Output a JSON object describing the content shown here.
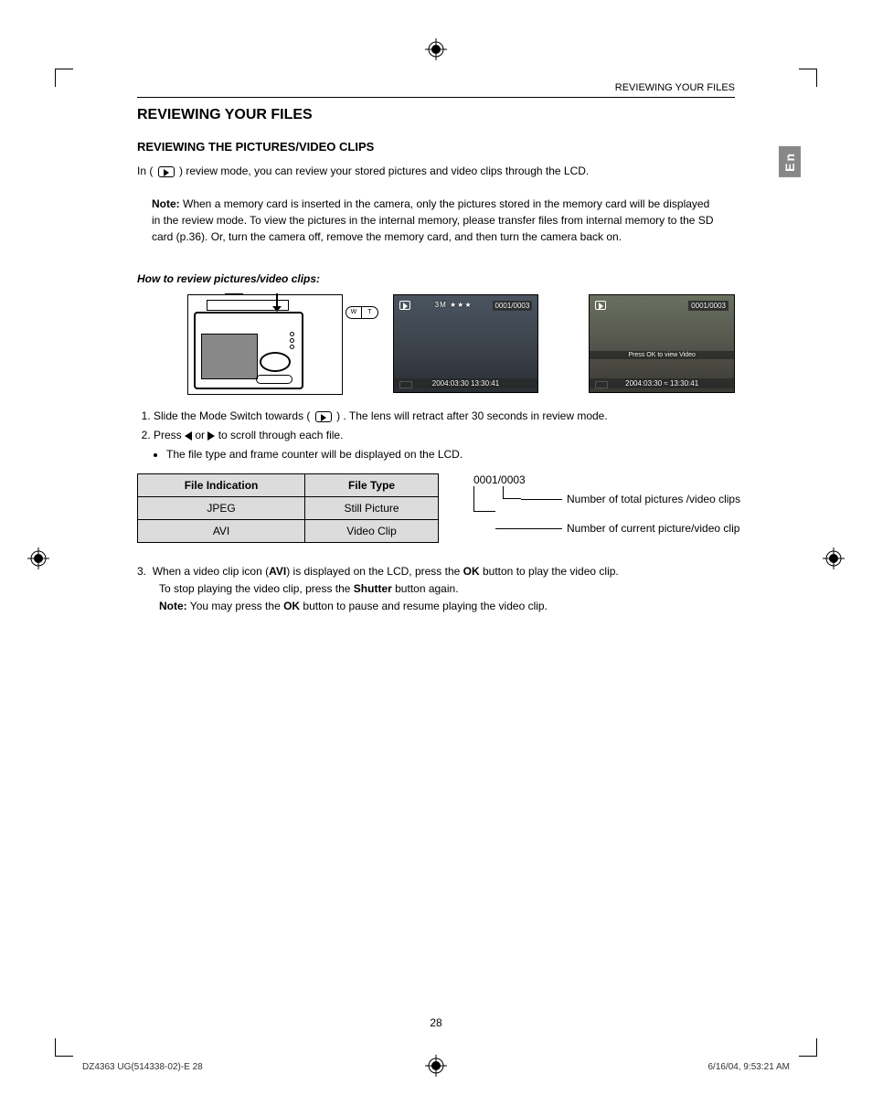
{
  "running_head": "REVIEWING YOUR FILES",
  "lang_tab": "En",
  "title": "REVIEWING YOUR FILES",
  "subtitle": "REVIEWING THE PICTURES/VIDEO CLIPS",
  "intro": "review mode, you can review your stored pictures and video clips through the LCD.",
  "intro_prefix": "In (",
  "intro_suffix": ")",
  "note_box": {
    "label": "Note:",
    "text": " When a memory card is inserted in the camera, only the pictures stored in the memory card will be displayed in the review mode. To view the pictures in the internal memory, please transfer files from internal memory to the SD card (p.36). Or, turn the camera off, remove the memory card, and then turn the camera back on."
  },
  "howto": "How to review pictures/video clips:",
  "lcd1": {
    "counter": "0001/0003",
    "stars": "3M ★★★",
    "datetime": "2004:03:30   13:30:41"
  },
  "lcd2": {
    "counter": "0001/0003",
    "press_ok": "Press OK to view Video",
    "datetime": "2004:03:30 ≈ 13:30:41"
  },
  "camera": {
    "slider_w": "W",
    "slider_t": "T"
  },
  "steps": {
    "s1a": "Slide the Mode Switch towards (",
    "s1b": ") . The lens will retract after 30 seconds in review mode.",
    "s2a": "Press ",
    "s2b": " or ",
    "s2c": " to scroll through each file.",
    "s2_bullet": "The file type and frame counter will be displayed on the LCD."
  },
  "table": {
    "h1": "File Indication",
    "h2": "File Type",
    "rows": [
      {
        "c1": "JPEG",
        "c2": "Still Picture"
      },
      {
        "c1": "AVI",
        "c2": "Video Clip"
      }
    ]
  },
  "counter_diagram": {
    "value": "0001/0003",
    "label1": "Number of total pictures /video clips",
    "label2": "Number of current picture/video clip"
  },
  "step3": {
    "num": "3.",
    "a": "When a video clip icon (",
    "avi": "AVI",
    "b": ") is displayed on the LCD, press the ",
    "ok": "OK",
    "c": " button to play the video clip.",
    "line2a": "To stop playing the video clip, press the ",
    "shutter": "Shutter",
    "line2b": " button again.",
    "note_label": "Note:",
    "note_a": " You may press the ",
    "note_b": " button to pause and resume playing the video clip."
  },
  "page_number": "28",
  "footer": {
    "left": "DZ4363 UG(514338-02)-E   28",
    "right": "6/16/04, 9:53:21 AM"
  }
}
